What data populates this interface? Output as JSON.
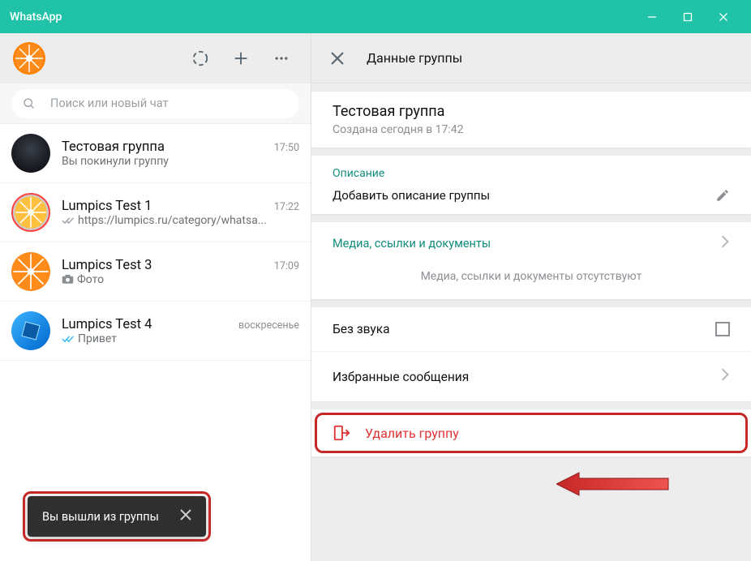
{
  "titlebar": {
    "title": "WhatsApp"
  },
  "search": {
    "placeholder": "Поиск или новый чат"
  },
  "chats": [
    {
      "name": "Тестовая группа",
      "time": "17:50",
      "snippet": "Вы покинули группу",
      "tick": "none"
    },
    {
      "name": "Lumpics Test 1",
      "time": "17:22",
      "snippet": "https://lumpics.ru/category/whatsa...",
      "tick": "grey"
    },
    {
      "name": "Lumpics Test 3",
      "time": "17:09",
      "snippet": "Фото",
      "tick": "none",
      "icon": "camera"
    },
    {
      "name": "Lumpics Test 4",
      "time": "воскресенье",
      "snippet": "Привет",
      "tick": "blue"
    }
  ],
  "panel": {
    "header": "Данные группы",
    "group_name": "Тестовая группа",
    "created": "Создана сегодня в 17:42",
    "desc_label": "Описание",
    "desc_placeholder": "Добавить описание группы",
    "media_label": "Медиа, ссылки и документы",
    "media_empty": "Медиа, ссылки и документы отсутствуют",
    "mute_label": "Без звука",
    "starred_label": "Избранные сообщения",
    "delete_label": "Удалить группу"
  },
  "toast": {
    "text": "Вы вышли из группы"
  }
}
